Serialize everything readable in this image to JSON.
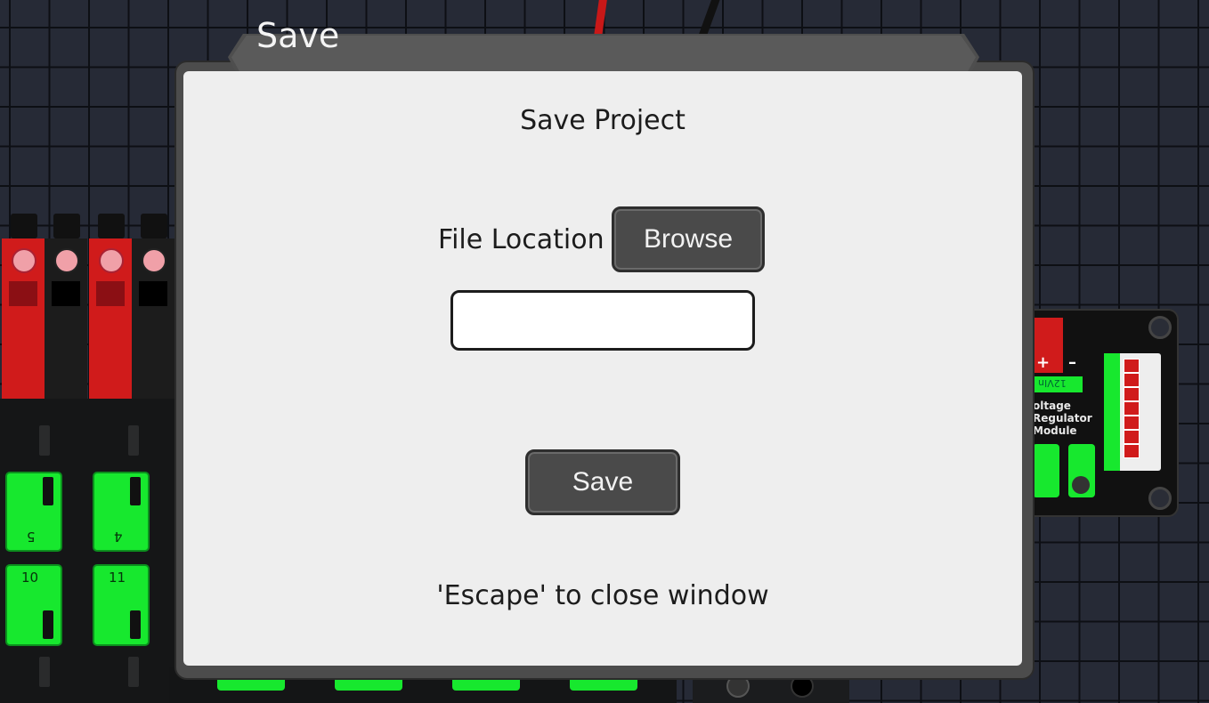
{
  "window": {
    "title": "Save"
  },
  "dialog": {
    "heading": "Save Project",
    "file_location_label": "File Location",
    "browse_label": "Browse",
    "path_value": "",
    "save_label": "Save",
    "hint": "'Escape' to close window"
  },
  "background": {
    "green_terminal_labels": [
      "5",
      "4",
      "10",
      "11"
    ],
    "module": {
      "power_label": "12VIn",
      "plus": "+",
      "minus": "–",
      "name_lines": [
        "oltage",
        "Regulator",
        "Module"
      ]
    }
  },
  "colors": {
    "grid_bg": "#262a36",
    "dialog_bg": "#eeeeee",
    "button_bg": "#4a4a4a",
    "terminal_red": "#d01b1b",
    "terminal_green": "#17e82e"
  }
}
